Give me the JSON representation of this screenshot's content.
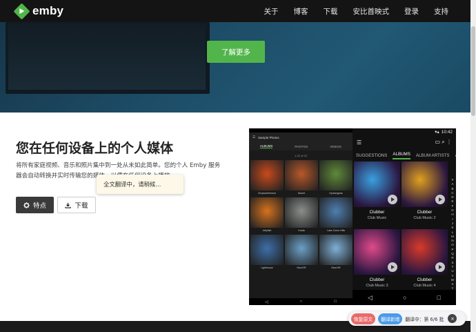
{
  "nav": {
    "brand": "emby",
    "links": [
      "关于",
      "博客",
      "下载",
      "安比首映式",
      "登录",
      "支持"
    ]
  },
  "hero": {
    "cta_label": "了解更多"
  },
  "main": {
    "title": "您在任何设备上的个人媒体",
    "description": "将所有家庭视频、音乐和照片集中到一处从未如此简单。您的个人 Emby 服务器会自动转换并实时传输您的媒体，以便在任何设备上播放。",
    "features_label": "特点",
    "download_label": "下载",
    "tooltip": "全文翻译中，请稍候..."
  },
  "tablet": {
    "header": "Sample Photos",
    "tabs": [
      "ALBUMS",
      "PHOTOS",
      "VIDEOS"
    ],
    "pager": "1-22 of 22",
    "photos": [
      {
        "label": "Chrysanthemum",
        "color": "#c84a1c"
      },
      {
        "label": "Desert",
        "color": "#b9582a"
      },
      {
        "label": "Hydrangeas",
        "color": "#5f8a3a"
      },
      {
        "label": "Jellyfish",
        "color": "#d6721e"
      },
      {
        "label": "Koala",
        "color": "#8b8f8c"
      },
      {
        "label": "Lake Como Hills",
        "color": "#4f7fb0"
      },
      {
        "label": "Lighthouse",
        "color": "#3d6fa8"
      },
      {
        "label": "Nice/VR",
        "color": "#6ca0c8"
      },
      {
        "label": "Nice/VR",
        "color": "#7eb0d8"
      }
    ],
    "nav": [
      "◁",
      "○",
      "□"
    ]
  },
  "phone": {
    "time": "10:42",
    "tabs": [
      "SUGGESTIONS",
      "ALBUMS",
      "ALBUM ARTISTS",
      "AR"
    ],
    "albums": [
      {
        "name": "Clubber",
        "sub": "Club Music",
        "color": "#3aa0e0"
      },
      {
        "name": "Clubber",
        "sub": "Club Music 2",
        "color": "#e0a020"
      },
      {
        "name": "Clubber",
        "sub": "Club Music 3",
        "color": "#e04a8a"
      },
      {
        "name": "Clubber",
        "sub": "Club Music 4",
        "color": "#d83a2a"
      }
    ],
    "alphabet": "#ABCDEFGHIJKLMNOPQRSTUVWXYZ",
    "nav": [
      "◁",
      "○",
      "□"
    ]
  },
  "translate": {
    "restore": "恢复原文",
    "new": "翻译新增",
    "status": "翻译中：第 6/6 批",
    "close": "×"
  }
}
